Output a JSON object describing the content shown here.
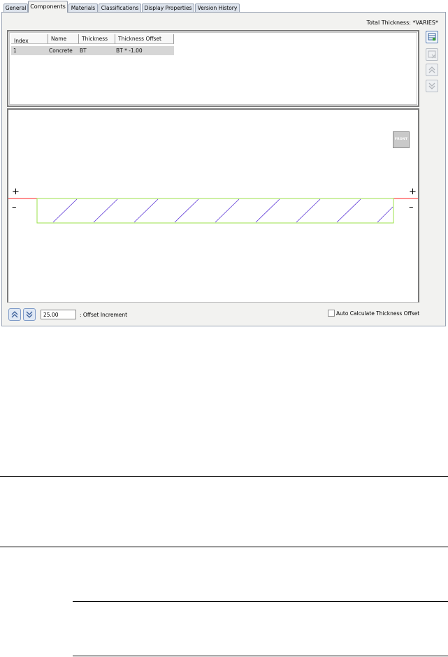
{
  "tabs": [
    {
      "label": "General",
      "active": false
    },
    {
      "label": "Components",
      "active": true
    },
    {
      "label": "Materials",
      "active": false
    },
    {
      "label": "Classifications",
      "active": false
    },
    {
      "label": "Display Properties",
      "active": false
    },
    {
      "label": "Version History",
      "active": false
    }
  ],
  "total_thickness": "Total Thickness: *VARIES*",
  "grid": {
    "columns": [
      "Index",
      "Name",
      "Thickness",
      "Thickness Offset"
    ],
    "rows": [
      {
        "index": "1",
        "name": "Concrete",
        "thickness": "BT",
        "offset": "BT * -1.00"
      }
    ]
  },
  "side_buttons": [
    "add-component",
    "remove-component",
    "move-up",
    "move-down"
  ],
  "preview": {
    "front_label": "FRONT",
    "plus": "+",
    "minus": "–",
    "colors": {
      "baseline": "#ff2020",
      "component": "#9be04a",
      "hatch": "#5a33d6"
    }
  },
  "controls": {
    "offset_value": "25.00",
    "offset_label": ": Offset Increment",
    "auto_calc_label": "Auto Calculate Thickness Offset",
    "auto_calc_checked": false
  }
}
